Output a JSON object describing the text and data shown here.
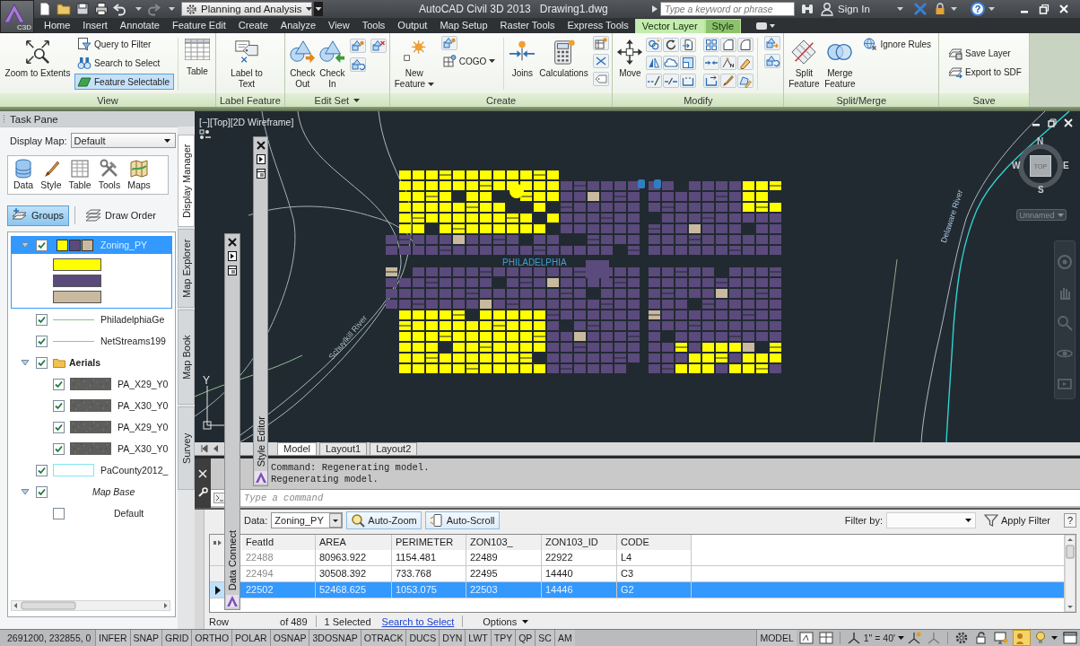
{
  "title_bar": {
    "app_badge": "C3D",
    "workspace": "Planning and Analysis",
    "title": "AutoCAD Civil 3D 2013",
    "document": "Drawing1.dwg",
    "search": {
      "placeholder": "Type a keyword or phrase"
    },
    "sign_in": "Sign In",
    "help": "?"
  },
  "ribbon_tabs": [
    {
      "label": "Home",
      "selected": false,
      "contextual": false
    },
    {
      "label": "Insert",
      "selected": false,
      "contextual": false
    },
    {
      "label": "Annotate",
      "selected": false,
      "contextual": false
    },
    {
      "label": "Feature Edit",
      "selected": false,
      "contextual": false
    },
    {
      "label": "Create",
      "selected": false,
      "contextual": false
    },
    {
      "label": "Analyze",
      "selected": false,
      "contextual": false
    },
    {
      "label": "View",
      "selected": false,
      "contextual": false
    },
    {
      "label": "Tools",
      "selected": false,
      "contextual": false
    },
    {
      "label": "Output",
      "selected": false,
      "contextual": false
    },
    {
      "label": "Map Setup",
      "selected": false,
      "contextual": false
    },
    {
      "label": "Raster Tools",
      "selected": false,
      "contextual": false
    },
    {
      "label": "Express Tools",
      "selected": false,
      "contextual": false
    },
    {
      "label": "Vector Layer",
      "selected": true,
      "contextual": true
    },
    {
      "label": "Style",
      "selected": false,
      "contextual": true
    }
  ],
  "ribbon_panels": [
    {
      "title": "View",
      "has_menu": false,
      "buttons": [
        {
          "label": "Zoom to Extents",
          "on": false
        },
        {
          "label": "Query to Filter",
          "on": false
        },
        {
          "label": "Search to Select",
          "on": false
        },
        {
          "label": "Feature Selectable",
          "on": true
        },
        {
          "label": "Table",
          "on": false
        }
      ]
    },
    {
      "title": "Label Feature",
      "has_menu": false,
      "buttons": [
        {
          "label": "Label to Text"
        }
      ]
    },
    {
      "title": "Edit Set",
      "has_menu": true,
      "buttons": [
        {
          "label": "Check Out"
        },
        {
          "label": "Check In"
        }
      ]
    },
    {
      "title": "Create",
      "has_menu": false,
      "buttons": [
        {
          "label": "New Feature",
          "has_menu": true
        },
        {
          "label": "COGO",
          "has_menu": true
        },
        {
          "label": "Joins",
          "has_menu": false
        },
        {
          "label": "Calculations",
          "has_menu": false
        }
      ]
    },
    {
      "title": "Modify",
      "has_menu": false,
      "buttons": [
        {
          "label": "Move"
        }
      ]
    },
    {
      "title": "Split/Merge",
      "has_menu": false,
      "buttons": [
        {
          "label": "Split Feature"
        },
        {
          "label": "Merge Feature"
        },
        {
          "label": "Ignore Rules"
        }
      ]
    },
    {
      "title": "Save",
      "has_menu": false,
      "buttons": [
        {
          "label": "Save Layer"
        },
        {
          "label": "Export to SDF"
        }
      ]
    }
  ],
  "task_pane": {
    "title": "Task Pane",
    "display_map": {
      "label": "Display Map:",
      "value": "Default"
    },
    "tools": [
      {
        "label": "Data"
      },
      {
        "label": "Style"
      },
      {
        "label": "Table"
      },
      {
        "label": "Tools"
      },
      {
        "label": "Maps"
      }
    ],
    "view_buttons": [
      {
        "label": "Groups",
        "selected": true
      },
      {
        "label": "Draw Order",
        "selected": false
      }
    ],
    "tabs": [
      {
        "label": "Display Manager",
        "selected": true
      },
      {
        "label": "Map Explorer",
        "selected": false
      },
      {
        "label": "Map Book",
        "selected": false
      },
      {
        "label": "Survey",
        "selected": false
      }
    ]
  },
  "layers": [
    {
      "kind": "polygon",
      "name": "Zoning_PY",
      "checked": true,
      "selected": true,
      "expanded": true,
      "legend": [
        {
          "color": "#ffff00"
        },
        {
          "color": "#5b4a7c"
        },
        {
          "color": "#c9b99f"
        }
      ]
    },
    {
      "kind": "line",
      "name": "PhiladelphiaGe",
      "checked": true,
      "selected": false,
      "color": "#8fbf8f"
    },
    {
      "kind": "line",
      "name": "NetStreams199",
      "checked": true,
      "selected": false,
      "color": "#9db3cf"
    },
    {
      "kind": "group",
      "name": "Aerials",
      "checked": true,
      "selected": false,
      "expanded": true,
      "children": [
        {
          "kind": "raster",
          "name": "PA_X29_Y0",
          "checked": true,
          "selected": false
        },
        {
          "kind": "raster",
          "name": "PA_X30_Y0",
          "checked": true,
          "selected": false
        },
        {
          "kind": "raster",
          "name": "PA_X29_Y0",
          "checked": true,
          "selected": false
        },
        {
          "kind": "raster",
          "name": "PA_X30_Y0",
          "checked": true,
          "selected": false
        }
      ]
    },
    {
      "kind": "outline",
      "name": "PaCounty2012_",
      "checked": true,
      "selected": false,
      "color": "#7fe8ee"
    },
    {
      "kind": "base_group",
      "name": "Map Base",
      "checked": true,
      "selected": false,
      "expanded": true,
      "children": [
        {
          "kind": "base_layer",
          "name": "Default",
          "checked": false,
          "selected": false
        }
      ]
    }
  ],
  "viewport": {
    "controls": [
      "[−]",
      "[Top]",
      "[2D Wireframe]"
    ],
    "map_labels": [
      "PHILADELPHIA",
      "Schuylkill River",
      "Delaware River"
    ],
    "compass": {
      "north": "N",
      "west": "W",
      "east": "E",
      "south": "S",
      "face": "TOP"
    },
    "view_menu": "Unnamed",
    "ucs_axis": "Y"
  },
  "palettes": [
    {
      "title": "Style Editor"
    },
    {
      "title": "Data Connect"
    }
  ],
  "layout_tabs": [
    {
      "label": "Model",
      "selected": true
    },
    {
      "label": "Layout1",
      "selected": false
    },
    {
      "label": "Layout2",
      "selected": false
    }
  ],
  "command_line": {
    "history": [
      "Command: Regenerating model.",
      "Regenerating model."
    ],
    "placeholder": "Type a command"
  },
  "data_table": {
    "source_label": "Data:",
    "source": "Zoning_PY",
    "buttons": [
      "Auto-Zoom",
      "Auto-Scroll"
    ],
    "filter_label": "Filter by:",
    "apply_filter": "Apply Filter",
    "help": "?",
    "columns": [
      "FeatId",
      "AREA",
      "PERIMETER",
      "ZON103_",
      "ZON103_ID",
      "CODE"
    ],
    "rows": [
      {
        "cells": [
          "22488",
          "80963.922",
          "1154.481",
          "22489",
          "22922",
          "L4"
        ],
        "selected": false
      },
      {
        "cells": [
          "22494",
          "30508.392",
          "733.768",
          "22495",
          "14440",
          "C3"
        ],
        "selected": false
      },
      {
        "cells": [
          "22502",
          "52468.625",
          "1053.075",
          "22503",
          "14446",
          "G2"
        ],
        "selected": true
      }
    ],
    "footer": {
      "rows_label": "Row",
      "count": "of 489",
      "selected_count": "1 Selected",
      "link": "Search to Select",
      "options": "Options"
    }
  },
  "status_bar": {
    "coordinates": "2691200, 232855, 0",
    "toggles": [
      "INFER",
      "SNAP",
      "GRID",
      "ORTHO",
      "POLAR",
      "OSNAP",
      "3DOSNAP",
      "OTRACK",
      "DUCS",
      "DYN",
      "LWT",
      "TPY",
      "QP",
      "SC",
      "AM"
    ],
    "space": "MODEL",
    "scale": "1\" = 40'"
  }
}
